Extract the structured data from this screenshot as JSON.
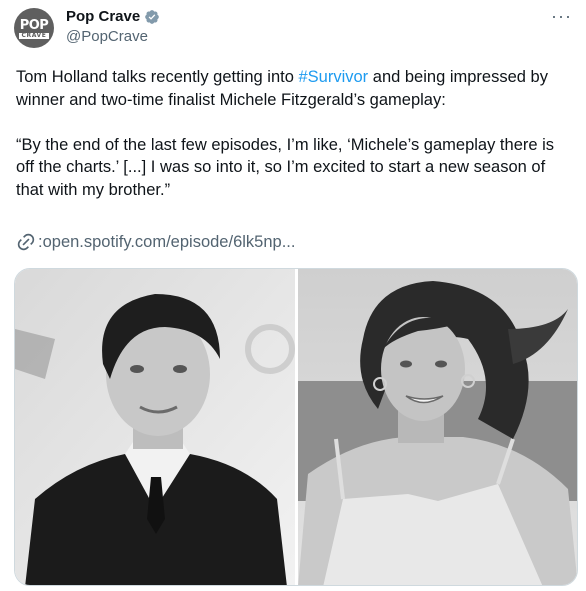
{
  "author": {
    "avatar_text_top": "POP",
    "avatar_text_bottom": "CRAVE",
    "display_name": "Pop Crave",
    "handle": "@PopCrave"
  },
  "menu": {
    "more_label": "···"
  },
  "tweet": {
    "text_before_hashtag": "Tom Holland talks recently getting into ",
    "hashtag": "#Survivor",
    "text_after_hashtag": " and being impressed by winner and two-time finalist Michele Fitzgerald’s gameplay:\n\n“By the end of the last few episodes, I’m like, ‘Michele’s gameplay there is off the charts.’ [...] I was so into it, so I’m excited to start a new season of that with my brother.”",
    "link_prefix": ":",
    "link_text": " open.spotify.com/episode/6lk5np..."
  },
  "colors": {
    "link": "#1d9bf0",
    "verified": "#829aab",
    "muted": "#536471"
  },
  "icons": {
    "verified": "verified-badge-icon",
    "link": "link-icon",
    "more": "more-icon"
  }
}
